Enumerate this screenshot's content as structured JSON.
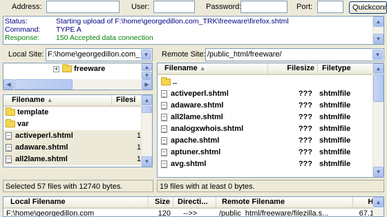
{
  "quickconnect": {
    "address_label": "Address:",
    "address_value": "",
    "user_label": "User:",
    "user_value": "",
    "password_label": "Password:",
    "password_value": "",
    "port_label": "Port:",
    "port_value": "",
    "button_label": "Quickconnect"
  },
  "log": [
    {
      "key": "Status:",
      "text": "Starting upload of F:\\home\\georgedillon.com_TRK\\freeware\\firefox.shtml",
      "color": "#000080"
    },
    {
      "key": "Command:",
      "text": "TYPE A",
      "color": "#000080"
    },
    {
      "key": "Response:",
      "text": "150 Accepted data connection",
      "color": "#008000"
    }
  ],
  "local": {
    "site_label": "Local Site:",
    "site_value": "F:\\home\\georgedillon.com_",
    "tree_item": "freeware",
    "columns": [
      "Filename",
      "Filesi"
    ],
    "files": [
      {
        "name": "template",
        "size": "",
        "type": "folder"
      },
      {
        "name": "var",
        "size": "",
        "type": "folder"
      },
      {
        "name": "activeperl.shtml",
        "size": "1",
        "type": "file"
      },
      {
        "name": "adaware.shtml",
        "size": "1",
        "type": "file"
      },
      {
        "name": "all2lame.shtml",
        "size": "1",
        "type": "file"
      }
    ],
    "status": "Selected 57 files with 12740 bytes."
  },
  "remote": {
    "site_label": "Remote Site:",
    "site_value": "/public_html/freeware/",
    "columns": [
      "Filename",
      "Filesize",
      "Filetype"
    ],
    "files": [
      {
        "name": "..",
        "size": "",
        "filetype": "",
        "type": "folder"
      },
      {
        "name": "activeperl.shtml",
        "size": "???",
        "filetype": "shtmlfile",
        "type": "file"
      },
      {
        "name": "adaware.shtml",
        "size": "???",
        "filetype": "shtmlfile",
        "type": "file"
      },
      {
        "name": "all2lame.shtml",
        "size": "???",
        "filetype": "shtmlfile",
        "type": "file"
      },
      {
        "name": "analogxwhois.shtml",
        "size": "???",
        "filetype": "shtmlfile",
        "type": "file"
      },
      {
        "name": "apache.shtml",
        "size": "???",
        "filetype": "shtmlfile",
        "type": "file"
      },
      {
        "name": "aptuner.shtml",
        "size": "???",
        "filetype": "shtmlfile",
        "type": "file"
      },
      {
        "name": "avg.shtml",
        "size": "???",
        "filetype": "shtmlfile",
        "type": "file"
      }
    ],
    "status": "19 files with at least 0 bytes."
  },
  "queue": {
    "columns": [
      "Local Filename",
      "Size",
      "Directi...",
      "Remote Filename",
      "Ho"
    ],
    "rows": [
      {
        "local": "F:\\home\\georgedillon.com_",
        "size": "120",
        "direction": "-->>",
        "remote": "/public_html/freeware/filezilla.s...",
        "host": "67.1"
      }
    ]
  }
}
